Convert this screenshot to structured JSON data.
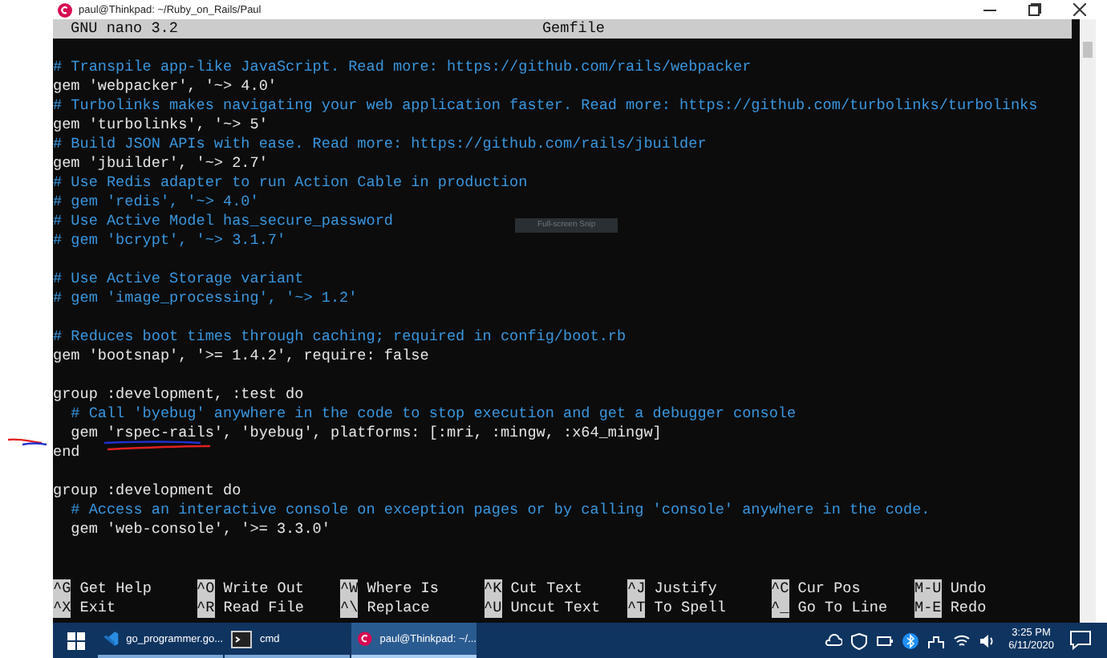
{
  "window": {
    "title": "paul@Thinkpad: ~/Ruby_on_Rails/Paul"
  },
  "nano_header": {
    "app": "GNU nano 3.2",
    "file": "Gemfile"
  },
  "lines": [
    {
      "kind": "comment",
      "text": "# Transpile app-like JavaScript. Read more: https://github.com/rails/webpacker"
    },
    {
      "kind": "code",
      "text": "gem 'webpacker', '~> 4.0'"
    },
    {
      "kind": "comment",
      "text": "# Turbolinks makes navigating your web application faster. Read more: https://github.com/turbolinks/turbolinks"
    },
    {
      "kind": "code",
      "text": "gem 'turbolinks', '~> 5'"
    },
    {
      "kind": "comment",
      "text": "# Build JSON APIs with ease. Read more: https://github.com/rails/jbuilder"
    },
    {
      "kind": "code",
      "text": "gem 'jbuilder', '~> 2.7'"
    },
    {
      "kind": "comment",
      "text": "# Use Redis adapter to run Action Cable in production"
    },
    {
      "kind": "comment",
      "text": "# gem 'redis', '~> 4.0'"
    },
    {
      "kind": "comment",
      "text": "# Use Active Model has_secure_password"
    },
    {
      "kind": "comment",
      "text": "# gem 'bcrypt', '~> 3.1.7'"
    },
    {
      "kind": "blank"
    },
    {
      "kind": "comment",
      "text": "# Use Active Storage variant"
    },
    {
      "kind": "comment",
      "text": "# gem 'image_processing', '~> 1.2'"
    },
    {
      "kind": "blank"
    },
    {
      "kind": "comment",
      "text": "# Reduces boot times through caching; required in config/boot.rb"
    },
    {
      "kind": "code",
      "text": "gem 'bootsnap', '>= 1.4.2', require: false"
    },
    {
      "kind": "blank"
    },
    {
      "kind": "code",
      "text": "group :development, :test do"
    },
    {
      "kind": "comment",
      "text": "  # Call 'byebug' anywhere in the code to stop execution and get a debugger console"
    },
    {
      "kind": "code",
      "text": "  gem 'rspec-rails', 'byebug', platforms: [:mri, :mingw, :x64_mingw]"
    },
    {
      "kind": "code",
      "text": "end"
    },
    {
      "kind": "blank"
    },
    {
      "kind": "code",
      "text": "group :development do"
    },
    {
      "kind": "comment",
      "text": "  # Access an interactive console on exception pages or by calling 'console' anywhere in the code."
    },
    {
      "kind": "code",
      "text": "  gem 'web-console', '>= 3.3.0'"
    }
  ],
  "snip_tooltip": "Full-screen Snip",
  "shortcuts": [
    [
      {
        "key": "^G",
        "label": "Get Help"
      },
      {
        "key": "^X",
        "label": "Exit"
      }
    ],
    [
      {
        "key": "^O",
        "label": "Write Out"
      },
      {
        "key": "^R",
        "label": "Read File"
      }
    ],
    [
      {
        "key": "^W",
        "label": "Where Is"
      },
      {
        "key": "^\\",
        "label": "Replace"
      }
    ],
    [
      {
        "key": "^K",
        "label": "Cut Text"
      },
      {
        "key": "^U",
        "label": "Uncut Text"
      }
    ],
    [
      {
        "key": "^J",
        "label": "Justify"
      },
      {
        "key": "^T",
        "label": "To Spell"
      }
    ],
    [
      {
        "key": "^C",
        "label": "Cur Pos"
      },
      {
        "key": "^_",
        "label": "Go To Line"
      }
    ],
    [
      {
        "key": "M-U",
        "label": "Undo"
      },
      {
        "key": "M-E",
        "label": "Redo"
      }
    ]
  ],
  "taskbar": {
    "apps": [
      {
        "kind": "editor",
        "label": "go_programmer.go...",
        "selected": false
      },
      {
        "kind": "terminal",
        "label": "cmd",
        "selected": false
      },
      {
        "kind": "debian",
        "label": "paul@Thinkpad: ~/...",
        "selected": true
      }
    ],
    "time": "3:25 PM",
    "date": "6/11/2020"
  }
}
